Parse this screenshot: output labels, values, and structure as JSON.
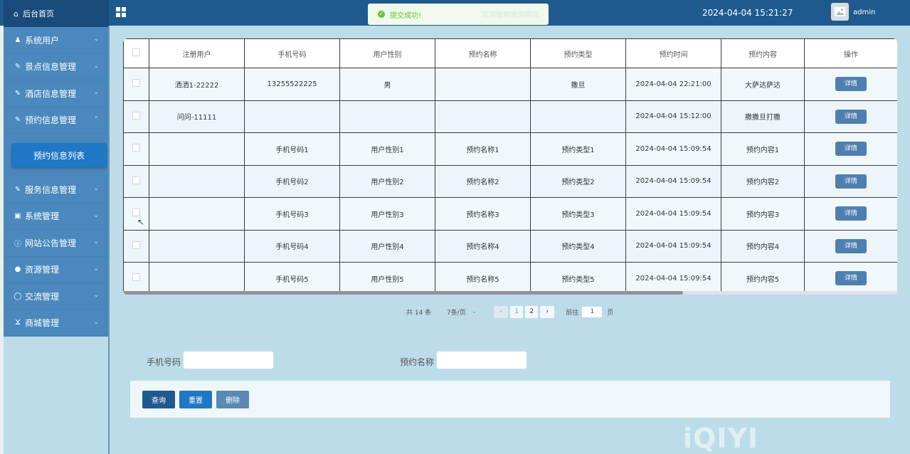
{
  "header": {
    "home_label": "后台首页",
    "toast_text": "提交成功!",
    "welcome_text": "欢迎使用旅游网站",
    "datetime": "2024-04-04 15:21:27",
    "username": "admin"
  },
  "sidebar": {
    "items": [
      {
        "label": "系统用户",
        "icon": "user-icon",
        "expanded": false
      },
      {
        "label": "景点信息管理",
        "icon": "edit-icon",
        "expanded": false
      },
      {
        "label": "酒店信息管理",
        "icon": "edit-icon",
        "expanded": false
      },
      {
        "label": "预约信息管理",
        "icon": "edit-icon",
        "expanded": true
      },
      {
        "label": "服务信息管理",
        "icon": "edit-icon",
        "expanded": false
      },
      {
        "label": "系统管理",
        "icon": "picture-icon",
        "expanded": false
      },
      {
        "label": "网站公告管理",
        "icon": "info-icon",
        "expanded": false
      },
      {
        "label": "资源管理",
        "icon": "location-icon",
        "expanded": false
      },
      {
        "label": "交流管理",
        "icon": "chat-icon",
        "expanded": false
      },
      {
        "label": "商城管理",
        "icon": "cart-icon",
        "expanded": false
      }
    ],
    "sub_item": "预约信息列表"
  },
  "table": {
    "columns": [
      "注册用户",
      "手机号码",
      "用户性别",
      "预约名称",
      "预约类型",
      "预约时间",
      "预约内容",
      "操作"
    ],
    "rows": [
      {
        "user": "洒洒1-22222",
        "phone": "13255522225",
        "gender": "男",
        "name": "",
        "type": "撒旦",
        "time": "2024-04-04 22:21:00",
        "content": "大萨达萨达"
      },
      {
        "user": "问问-11111",
        "phone": "",
        "gender": "",
        "name": "",
        "type": "",
        "time": "2024-04-04 15:12:00",
        "content": "撒撒旦打撒"
      },
      {
        "user": "",
        "phone": "手机号码1",
        "gender": "用户性别1",
        "name": "预约名称1",
        "type": "预约类型1",
        "time": "2024-04-04 15:09:54",
        "content": "预约内容1"
      },
      {
        "user": "",
        "phone": "手机号码2",
        "gender": "用户性别2",
        "name": "预约名称2",
        "type": "预约类型2",
        "time": "2024-04-04 15:09:54",
        "content": "预约内容2"
      },
      {
        "user": "",
        "phone": "手机号码3",
        "gender": "用户性别3",
        "name": "预约名称3",
        "type": "预约类型3",
        "time": "2024-04-04 15:09:54",
        "content": "预约内容3"
      },
      {
        "user": "",
        "phone": "手机号码4",
        "gender": "用户性别4",
        "name": "预约名称4",
        "type": "预约类型4",
        "time": "2024-04-04 15:09:54",
        "content": "预约内容4"
      },
      {
        "user": "",
        "phone": "手机号码5",
        "gender": "用户性别5",
        "name": "预约名称5",
        "type": "预约类型5",
        "time": "2024-04-04 15:09:54",
        "content": "预约内容5"
      }
    ],
    "detail_label": "详情"
  },
  "pagination": {
    "total_text": "共 14 条",
    "page_size": "7条/页",
    "pages": [
      "1",
      "2"
    ],
    "current_page": "1",
    "goto_label": "前往",
    "goto_value": "1",
    "page_suffix": "页"
  },
  "search": {
    "phone_label": "手机号码",
    "phone_value": "",
    "name_label": "预约名称",
    "name_value": ""
  },
  "actions": {
    "query": "查询",
    "reset": "重置",
    "delete": "删除"
  },
  "watermark": "iQIYI",
  "colors": {
    "topbar": "#1f5a8f",
    "sidebar_item": "#4a88bd",
    "active_sub": "#1f77c6",
    "background": "#bcdce9",
    "query_button": "#1f5a8f",
    "reset_button": "#1f77c6",
    "delete_button": "#5a89b4"
  }
}
